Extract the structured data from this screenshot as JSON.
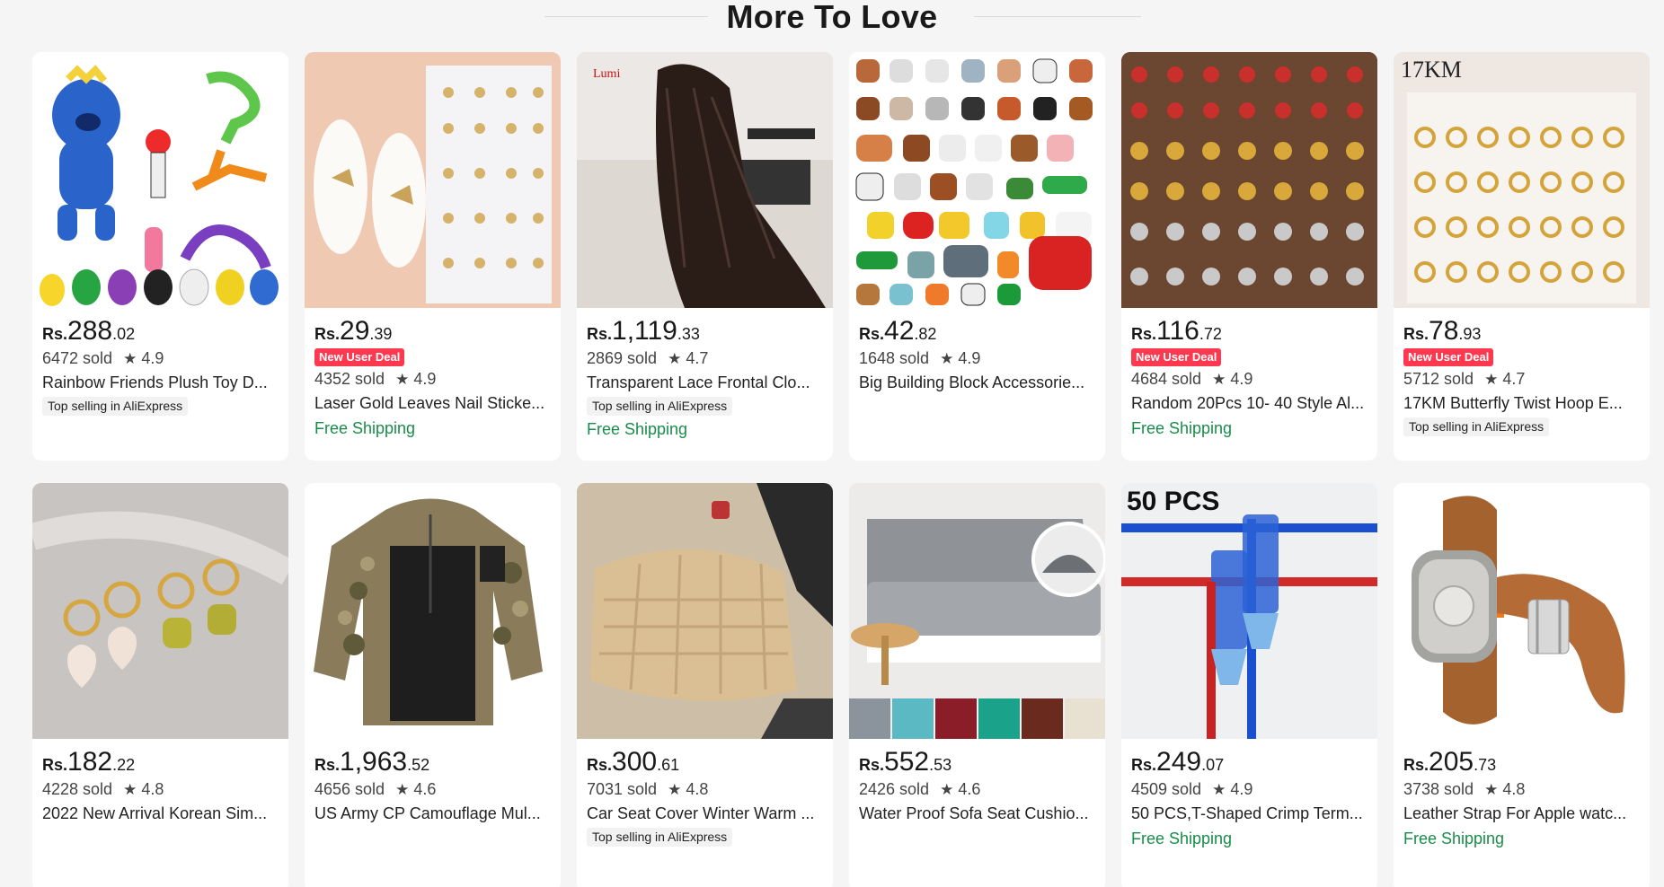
{
  "section": {
    "title": "More To Love"
  },
  "products": [
    {
      "currency": "Rs.",
      "price_int": "288",
      "price_dec": ".02",
      "deal": "",
      "sold": "6472 sold",
      "rating": "4.9",
      "title": "Rainbow Friends Plush Toy D...",
      "badge": "Top selling in AliExpress",
      "shipping": "",
      "image_icon": "plush-toy-image"
    },
    {
      "currency": "Rs.",
      "price_int": "29",
      "price_dec": ".39",
      "deal": "New User Deal",
      "sold": "4352 sold",
      "rating": "4.9",
      "title": "Laser Gold Leaves Nail Sticke...",
      "badge": "",
      "shipping": "Free Shipping",
      "image_icon": "nail-sticker-image"
    },
    {
      "currency": "Rs.",
      "price_int": "1,119",
      "price_dec": ".33",
      "deal": "",
      "sold": "2869 sold",
      "rating": "4.7",
      "title": "Transparent Lace Frontal Clo...",
      "badge": "Top selling in AliExpress",
      "shipping": "Free Shipping",
      "image_icon": "hair-wig-image"
    },
    {
      "currency": "Rs.",
      "price_int": "42",
      "price_dec": ".82",
      "deal": "",
      "sold": "1648 sold",
      "rating": "4.9",
      "title": "Big Building Block Accessorie...",
      "badge": "",
      "shipping": "",
      "image_icon": "building-block-animals-image"
    },
    {
      "currency": "Rs.",
      "price_int": "116",
      "price_dec": ".72",
      "deal": "New User Deal",
      "sold": "4684 sold",
      "rating": "4.9",
      "title": "Random 20Pcs 10- 40 Style Al...",
      "badge": "",
      "shipping": "Free Shipping",
      "image_icon": "christmas-charms-image"
    },
    {
      "currency": "Rs.",
      "price_int": "78",
      "price_dec": ".93",
      "deal": "New User Deal",
      "sold": "5712 sold",
      "rating": "4.7",
      "title": "17KM Butterfly Twist Hoop E...",
      "badge": "Top selling in AliExpress",
      "shipping": "",
      "image_icon": "earrings-set-image"
    },
    {
      "currency": "Rs.",
      "price_int": "182",
      "price_dec": ".22",
      "deal": "",
      "sold": "4228 sold",
      "rating": "4.8",
      "title": "2022 New Arrival Korean Sim...",
      "badge": "",
      "shipping": "",
      "image_icon": "heart-earrings-image"
    },
    {
      "currency": "Rs.",
      "price_int": "1,963",
      "price_dec": ".52",
      "deal": "",
      "sold": "4656 sold",
      "rating": "4.6",
      "title": "US Army CP Camouflage Mul...",
      "badge": "",
      "shipping": "",
      "image_icon": "camo-shirt-image"
    },
    {
      "currency": "Rs.",
      "price_int": "300",
      "price_dec": ".61",
      "deal": "",
      "sold": "7031 sold",
      "rating": "4.8",
      "title": "Car Seat Cover Winter Warm ...",
      "badge": "Top selling in AliExpress",
      "shipping": "",
      "image_icon": "car-seat-cover-image"
    },
    {
      "currency": "Rs.",
      "price_int": "552",
      "price_dec": ".53",
      "deal": "",
      "sold": "2426 sold",
      "rating": "4.6",
      "title": "Water Proof Sofa Seat Cushio...",
      "badge": "",
      "shipping": "",
      "image_icon": "sofa-cover-image"
    },
    {
      "currency": "Rs.",
      "price_int": "249",
      "price_dec": ".07",
      "deal": "",
      "sold": "4509 sold",
      "rating": "4.9",
      "title": "50 PCS,T-Shaped Crimp Term...",
      "badge": "",
      "shipping": "Free Shipping",
      "image_icon": "crimp-terminal-image",
      "image_caption": "50 PCS"
    },
    {
      "currency": "Rs.",
      "price_int": "205",
      "price_dec": ".73",
      "deal": "",
      "sold": "3738 sold",
      "rating": "4.8",
      "title": "Leather Strap For Apple watc...",
      "badge": "",
      "shipping": "Free Shipping",
      "image_icon": "watch-strap-image"
    }
  ],
  "star_glyph": "★"
}
